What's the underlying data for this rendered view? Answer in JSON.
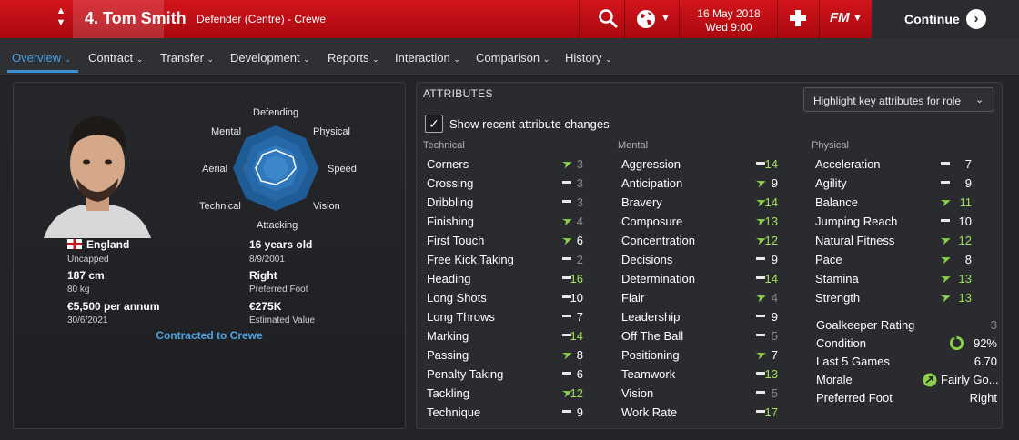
{
  "header": {
    "player_name": "4. Tom Smith",
    "player_role": "Defender (Centre) - Crewe",
    "date": "16 May 2018",
    "time": "Wed 9:00",
    "fm_label": "FM",
    "continue_label": "Continue"
  },
  "nav": {
    "tabs": [
      {
        "label": "Overview"
      },
      {
        "label": "Contract"
      },
      {
        "label": "Transfer"
      },
      {
        "label": "Development"
      },
      {
        "label": "Reports"
      },
      {
        "label": "Interaction"
      },
      {
        "label": "Comparison"
      },
      {
        "label": "History"
      }
    ]
  },
  "profile": {
    "radar_labels": {
      "defending": "Defending",
      "physical": "Physical",
      "speed": "Speed",
      "vision": "Vision",
      "attacking": "Attacking",
      "technical": "Technical",
      "aerial": "Aerial",
      "mental": "Mental"
    },
    "nationality": "England",
    "caps": "Uncapped",
    "height": "187 cm",
    "weight": "80 kg",
    "wage": "€5,500 per annum",
    "contract_end": "30/6/2021",
    "age": "16 years old",
    "dob": "8/9/2001",
    "preferred_foot_value": "Right",
    "preferred_foot_label": "Preferred Foot",
    "value": "€275K",
    "value_label": "Estimated Value",
    "contracted_to": "Contracted to Crewe"
  },
  "attributes": {
    "title": "ATTRIBUTES",
    "highlight_label": "Highlight key attributes for role",
    "show_changes_label": "Show recent attribute changes",
    "technical_header": "Technical",
    "mental_header": "Mental",
    "physical_header": "Physical",
    "technical": [
      {
        "name": "Corners",
        "trend": "up",
        "value": "3"
      },
      {
        "name": "Crossing",
        "trend": "flat",
        "value": "3"
      },
      {
        "name": "Dribbling",
        "trend": "flat",
        "value": "3"
      },
      {
        "name": "Finishing",
        "trend": "up",
        "value": "4"
      },
      {
        "name": "First Touch",
        "trend": "up",
        "value": "6"
      },
      {
        "name": "Free Kick Taking",
        "trend": "flat",
        "value": "2"
      },
      {
        "name": "Heading",
        "trend": "flat",
        "value": "16"
      },
      {
        "name": "Long Shots",
        "trend": "flat",
        "value": "10"
      },
      {
        "name": "Long Throws",
        "trend": "flat",
        "value": "7"
      },
      {
        "name": "Marking",
        "trend": "flat",
        "value": "14"
      },
      {
        "name": "Passing",
        "trend": "up",
        "value": "8"
      },
      {
        "name": "Penalty Taking",
        "trend": "flat",
        "value": "6"
      },
      {
        "name": "Tackling",
        "trend": "up",
        "value": "12"
      },
      {
        "name": "Technique",
        "trend": "flat",
        "value": "9"
      }
    ],
    "mental": [
      {
        "name": "Aggression",
        "trend": "flat",
        "value": "14"
      },
      {
        "name": "Anticipation",
        "trend": "up",
        "value": "9"
      },
      {
        "name": "Bravery",
        "trend": "up",
        "value": "14"
      },
      {
        "name": "Composure",
        "trend": "up",
        "value": "13"
      },
      {
        "name": "Concentration",
        "trend": "up",
        "value": "12"
      },
      {
        "name": "Decisions",
        "trend": "flat",
        "value": "9"
      },
      {
        "name": "Determination",
        "trend": "flat",
        "value": "14"
      },
      {
        "name": "Flair",
        "trend": "up",
        "value": "4"
      },
      {
        "name": "Leadership",
        "trend": "flat",
        "value": "9"
      },
      {
        "name": "Off The Ball",
        "trend": "flat",
        "value": "5"
      },
      {
        "name": "Positioning",
        "trend": "up",
        "value": "7"
      },
      {
        "name": "Teamwork",
        "trend": "flat",
        "value": "13"
      },
      {
        "name": "Vision",
        "trend": "flat",
        "value": "5"
      },
      {
        "name": "Work Rate",
        "trend": "flat",
        "value": "17"
      }
    ],
    "physical": [
      {
        "name": "Acceleration",
        "trend": "flat",
        "value": "7"
      },
      {
        "name": "Agility",
        "trend": "flat",
        "value": "9"
      },
      {
        "name": "Balance",
        "trend": "up",
        "value": "11"
      },
      {
        "name": "Jumping Reach",
        "trend": "flat",
        "value": "10"
      },
      {
        "name": "Natural Fitness",
        "trend": "up",
        "value": "12"
      },
      {
        "name": "Pace",
        "trend": "up",
        "value": "8"
      },
      {
        "name": "Stamina",
        "trend": "up",
        "value": "13"
      },
      {
        "name": "Strength",
        "trend": "up",
        "value": "13"
      }
    ],
    "stats": {
      "gk_rating_label": "Goalkeeper Rating",
      "gk_rating_value": "3",
      "condition_label": "Condition",
      "condition_value": "92%",
      "condition_fraction": 0.92,
      "last5_label": "Last 5 Games",
      "last5_value": "6.70",
      "morale_label": "Morale",
      "morale_value": "Fairly Go...",
      "foot_label": "Preferred Foot",
      "foot_value": "Right"
    }
  },
  "colors": {
    "header_red": "#c80d14",
    "accent_blue": "#3d8fd6",
    "good_green": "#8bd14a",
    "high_value_green": "#9ee05a"
  }
}
